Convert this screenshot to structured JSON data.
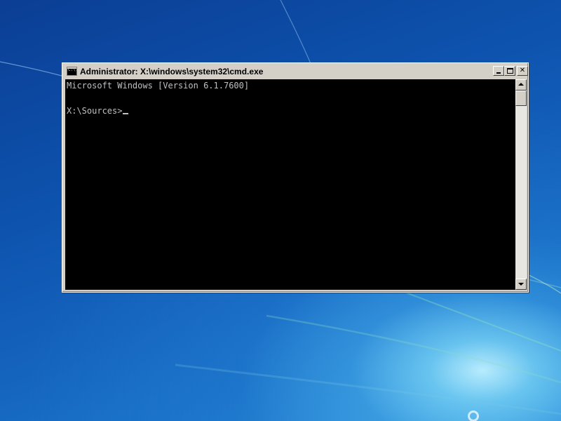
{
  "window": {
    "title": "Administrator: X:\\windows\\system32\\cmd.exe",
    "icon_label": "C:\\.",
    "controls": {
      "minimize": "minimize-icon",
      "maximize": "maximize-icon",
      "close_label": "✕"
    }
  },
  "console": {
    "lines": [
      "Microsoft Windows [Version 6.1.7600]",
      "",
      "X:\\Sources>"
    ]
  },
  "colors": {
    "console_background": "#000000",
    "console_text": "#c0c0c0",
    "chrome": "#d4d0c8",
    "desktop": "#1463bd"
  },
  "desktop": {
    "cursor_icon": "busy-cursor-icon"
  }
}
